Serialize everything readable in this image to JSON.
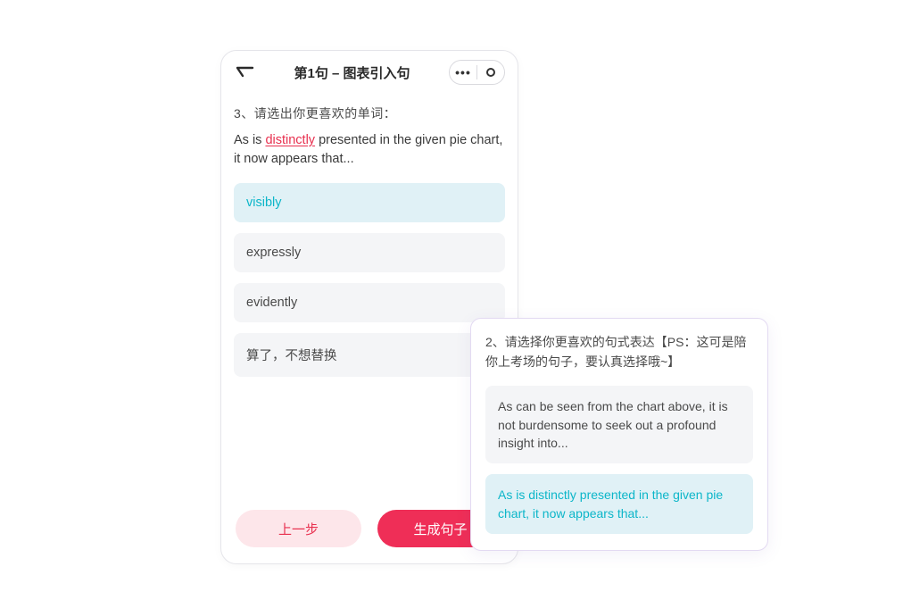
{
  "header": {
    "title": "第1句 – 图表引入句"
  },
  "question": {
    "number_label": "3、",
    "prompt": "请选出你更喜欢的单词：",
    "sentence_pre": "As is ",
    "highlight": "distinctly",
    "sentence_post": " presented in the given pie chart, it now appears that..."
  },
  "options": [
    {
      "label": "visibly",
      "selected": true
    },
    {
      "label": "expressly",
      "selected": false
    },
    {
      "label": "evidently",
      "selected": false
    },
    {
      "label": "算了，不想替换",
      "selected": false
    }
  ],
  "footer": {
    "prev": "上一步",
    "primary": "生成句子"
  },
  "popup": {
    "prompt": "2、请选择你更喜欢的句式表达【PS：这可是陪你上考场的句子，要认真选择哦~】",
    "options": [
      {
        "label": "As can be seen from the chart above, it is not burdensome to seek out a profound insight into...",
        "selected": false
      },
      {
        "label": "As is distinctly presented in the given pie chart, it now appears that...",
        "selected": true
      }
    ]
  }
}
